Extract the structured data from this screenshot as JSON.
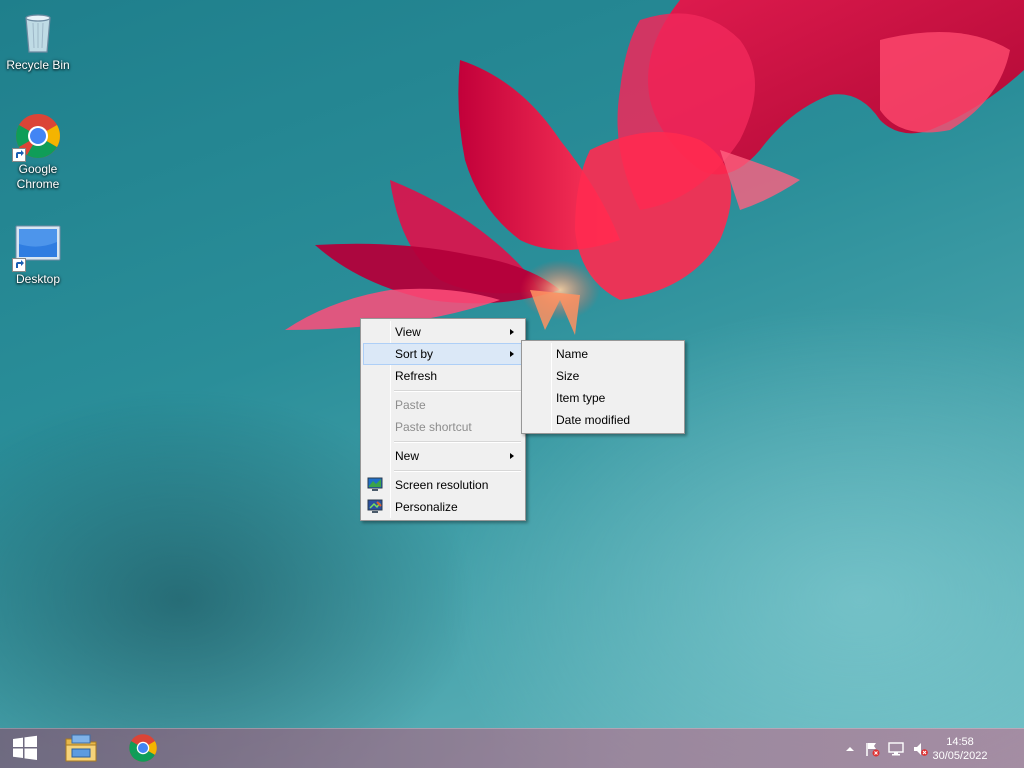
{
  "desktop": {
    "icons": [
      {
        "label": "Recycle Bin"
      },
      {
        "label": "Google\nChrome"
      },
      {
        "label": "Desktop"
      }
    ]
  },
  "context_menu": {
    "items": [
      {
        "label": "View",
        "has_submenu": true
      },
      {
        "label": "Sort by",
        "has_submenu": true,
        "highlighted": true
      },
      {
        "label": "Refresh"
      },
      {
        "label": "Paste",
        "disabled": true
      },
      {
        "label": "Paste shortcut",
        "disabled": true
      },
      {
        "label": "New",
        "has_submenu": true
      },
      {
        "label": "Screen resolution",
        "icon": "screen-resolution-icon"
      },
      {
        "label": "Personalize",
        "icon": "personalize-icon"
      }
    ]
  },
  "sort_submenu": {
    "items": [
      {
        "label": "Name"
      },
      {
        "label": "Size"
      },
      {
        "label": "Item type"
      },
      {
        "label": "Date modified"
      }
    ]
  },
  "taskbar": {
    "start_icon": "windows-logo-icon",
    "pinned": [
      "file-explorer-icon",
      "chrome-icon"
    ],
    "tray_icons": [
      "show-hidden-icons-chevron",
      "action-center-flag-icon",
      "network-icon",
      "volume-muted-icon"
    ],
    "clock": {
      "time": "14:58",
      "date": "30/05/2022"
    }
  },
  "colors": {
    "menu_bg": "#f0f0f0",
    "menu_highlight": "#dbe8f7",
    "menu_highlight_border": "#aecff7"
  }
}
